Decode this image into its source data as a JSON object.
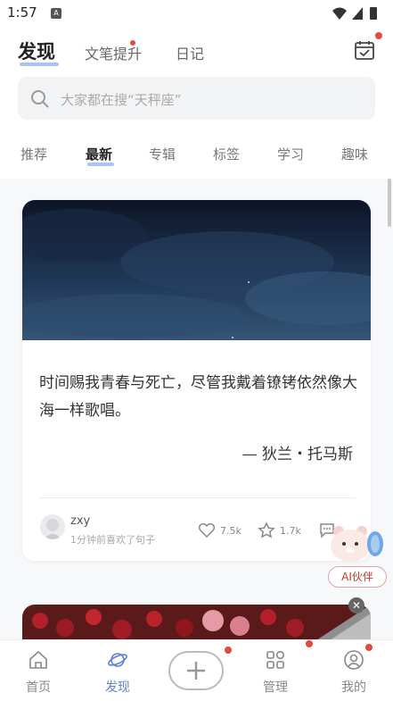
{
  "status_bar": {
    "time": "1:57"
  },
  "header": {
    "tabs": [
      {
        "label": "发现",
        "active": true
      },
      {
        "label": "文笔提升",
        "has_dot": true
      },
      {
        "label": "日记"
      }
    ]
  },
  "search": {
    "placeholder": "大家都在搜“天秤座”"
  },
  "categories": [
    {
      "label": "推荐"
    },
    {
      "label": "最新",
      "active": true
    },
    {
      "label": "专辑"
    },
    {
      "label": "标签"
    },
    {
      "label": "学习"
    },
    {
      "label": "趣味"
    }
  ],
  "card": {
    "quote": "时间赐我青春与死亡，尽管我戴着镣铐依然像大海一样歌唱。",
    "author": "— 狄兰・托马斯",
    "username": "zxy",
    "subline": "1分钟前喜欢了句子",
    "likes": "7.5k",
    "favorites": "1.7k"
  },
  "ai_companion": {
    "label": "AI伙伴"
  },
  "bottom_nav": [
    {
      "label": "首页",
      "icon": "home-icon"
    },
    {
      "label": "发现",
      "icon": "planet-icon",
      "active": true
    },
    {
      "label": "",
      "icon": "plus-icon"
    },
    {
      "label": "管理",
      "icon": "grid-icon",
      "has_dot": true
    },
    {
      "label": "我的",
      "icon": "profile-icon",
      "has_dot": true
    }
  ],
  "colors": {
    "accent": "#5b84d6",
    "underline": "#a9c4f3",
    "badge": "#e8473b"
  }
}
